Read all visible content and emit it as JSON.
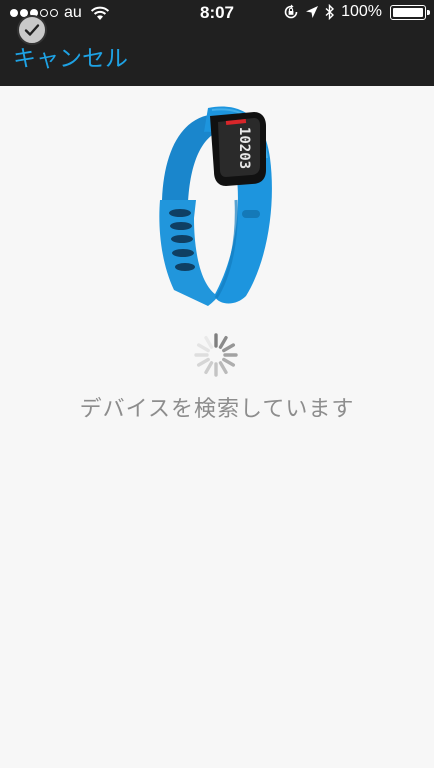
{
  "status_bar": {
    "carrier": "au",
    "time": "8:07",
    "battery_percent": "100%",
    "signal_bars_filled": 3,
    "signal_bars_total": 5
  },
  "nav": {
    "cancel_label": "キャンセル"
  },
  "device": {
    "display_reading": "10203"
  },
  "main": {
    "status_text": "デバイスを検索しています"
  },
  "colors": {
    "accent": "#1ea2e4",
    "topbar": "#202020",
    "background": "#f7f7f7",
    "band": "#1d8fd6"
  }
}
